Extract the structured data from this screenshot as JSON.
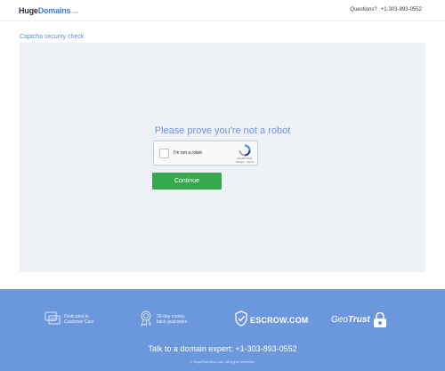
{
  "header": {
    "logo_huge": "Huge",
    "logo_domains": "Domains",
    "logo_tld": ".com",
    "questions_label": "Questions?",
    "phone": "+1-303-893-0552"
  },
  "breadcrumb": "Captcha security check",
  "captcha": {
    "prompt": "Please prove you're not a robot",
    "checkbox_label": "I'm not a robot",
    "recaptcha_text": "reCAPTCHA",
    "recaptcha_links": "Privacy - Terms",
    "continue_label": "Continue"
  },
  "footer": {
    "badges": [
      {
        "line1": "Dedicated to",
        "line2": "Customer Care",
        "icon": "customer-care-icon"
      },
      {
        "line1": "30-day money",
        "line2": "back guarantee",
        "icon": "money-back-icon"
      },
      {
        "text": "ESCROW.COM",
        "icon": "escrow-shield-icon"
      },
      {
        "text_a": "Geo",
        "text_b": "Trust",
        "icon": "geotrust-lock-icon"
      }
    ],
    "talk": "Talk to a domain expert: +1-303-893-0552",
    "copyright": "© HugeDomains.com. All rights reserved."
  },
  "colors": {
    "brand_blue": "#3b7dd8",
    "link_blue": "#5a8ad8",
    "panel_bg": "#eef1f6",
    "continue_green": "#35a94b",
    "footer_blue": "#6b98dc"
  }
}
